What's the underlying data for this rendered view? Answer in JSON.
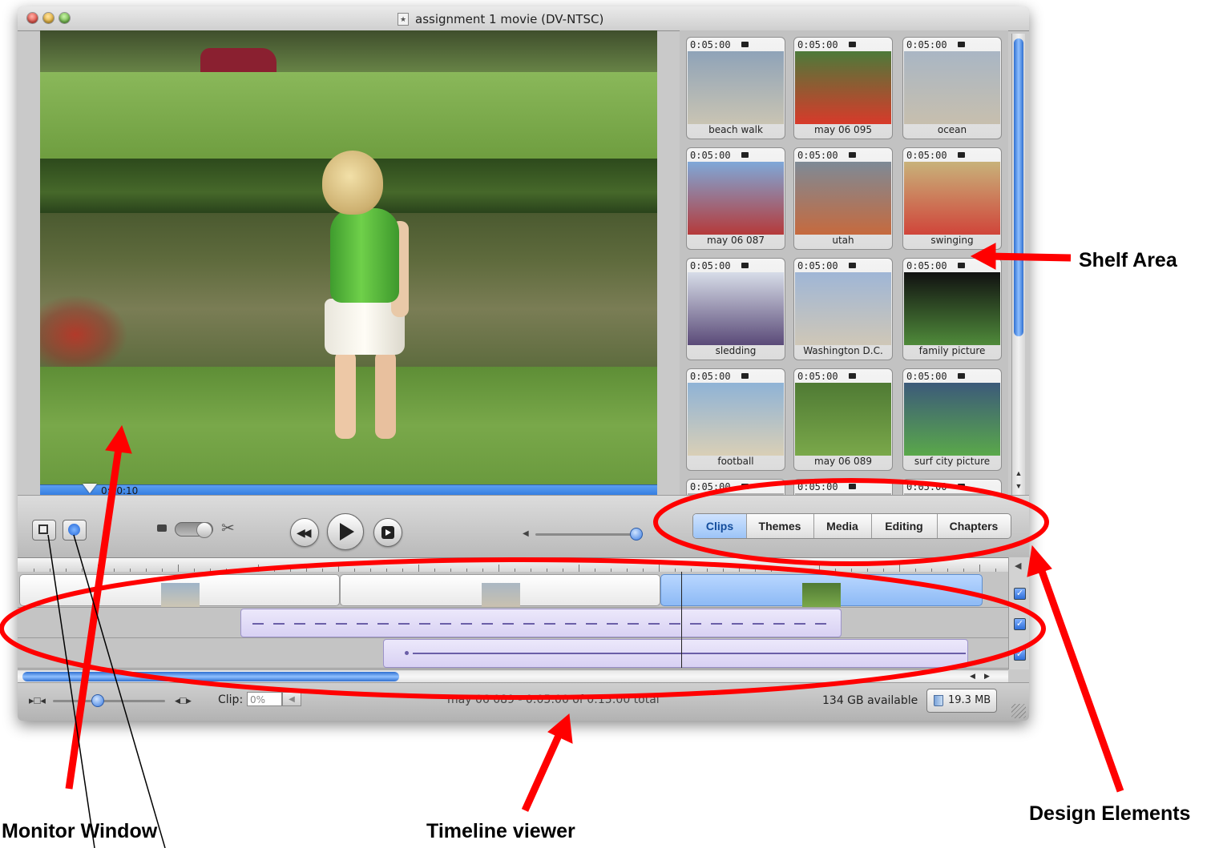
{
  "window": {
    "title": "assignment 1 movie (DV-NTSC)",
    "doc_icon": "★"
  },
  "monitor": {
    "timecode": "0:10:10"
  },
  "shelf": {
    "clips": [
      {
        "duration": "0:05:00",
        "name": "beach walk",
        "thumb_colors": [
          "#8fa3b8",
          "#c9c4b3"
        ]
      },
      {
        "duration": "0:05:00",
        "name": "may 06 095",
        "thumb_colors": [
          "#4c7a3a",
          "#d83a2a"
        ]
      },
      {
        "duration": "0:05:00",
        "name": "ocean",
        "thumb_colors": [
          "#a9b6c4",
          "#c7bfae"
        ]
      },
      {
        "duration": "0:05:00",
        "name": "may 06 087",
        "thumb_colors": [
          "#7fa8d8",
          "#b53a3a"
        ]
      },
      {
        "duration": "0:05:00",
        "name": "utah",
        "thumb_colors": [
          "#7e8a96",
          "#c66a3e"
        ]
      },
      {
        "duration": "0:05:00",
        "name": "swinging",
        "thumb_colors": [
          "#c8b27a",
          "#d0453a"
        ]
      },
      {
        "duration": "0:05:00",
        "name": "sledding",
        "thumb_colors": [
          "#d7dde8",
          "#5a4a78"
        ]
      },
      {
        "duration": "0:05:00",
        "name": "Washington D.C.",
        "thumb_colors": [
          "#9fb6d6",
          "#cfc7b7"
        ]
      },
      {
        "duration": "0:05:00",
        "name": "family picture",
        "thumb_colors": [
          "#111111",
          "#4f8a3a"
        ]
      },
      {
        "duration": "0:05:00",
        "name": "football",
        "thumb_colors": [
          "#8fb3d6",
          "#d9cfb6"
        ]
      },
      {
        "duration": "0:05:00",
        "name": "may 06 089",
        "thumb_colors": [
          "#4f7a34",
          "#7aa84a"
        ]
      },
      {
        "duration": "0:05:00",
        "name": "surf city picture",
        "thumb_colors": [
          "#3c5a7a",
          "#5aa84a"
        ]
      },
      {
        "duration": "0:05:00",
        "name": "",
        "thumb_colors": [
          "#b0b0b0",
          "#b0b0b0"
        ]
      },
      {
        "duration": "0:05:00",
        "name": "",
        "thumb_colors": [
          "#b0b0b0",
          "#b0b0b0"
        ]
      },
      {
        "duration": "0:05:00",
        "name": "",
        "thumb_colors": [
          "#b0b0b0",
          "#b0b0b0"
        ]
      }
    ]
  },
  "design_tabs": [
    "Clips",
    "Themes",
    "Media",
    "Editing",
    "Chapters"
  ],
  "design_tabs_selected": "Clips",
  "statusbar": {
    "clip_label": "Clip:",
    "clip_volume": "0%",
    "status_text": "may 06 089 - 0:05:00 of 0:15:00 total",
    "disk_space": "134 GB available",
    "trash_size": "19.3 MB"
  },
  "annotations": {
    "shelf_area": "Shelf Area",
    "monitor_window": "Monitor Window",
    "timeline_viewer": "Timeline viewer",
    "design_elements": "Design Elements",
    "color": "#ff0000"
  }
}
